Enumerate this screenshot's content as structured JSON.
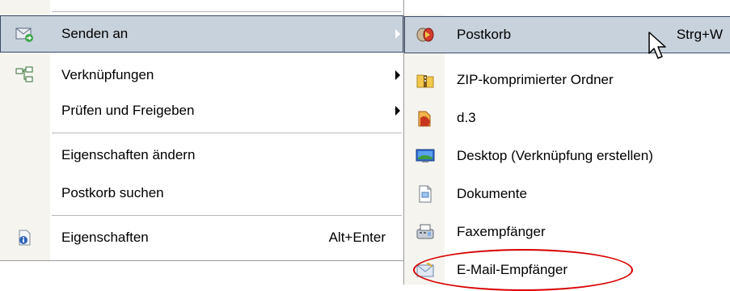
{
  "left_menu": {
    "items": [
      {
        "label": "Senden an",
        "icon": "envelope-arrow-icon",
        "submenu": true,
        "highlighted": true
      },
      {
        "label": "Verknüpfungen",
        "icon": "link-tree-icon",
        "submenu": true
      },
      {
        "label": "Prüfen und Freigeben",
        "submenu": true
      },
      {
        "label": "Eigenschaften ändern"
      },
      {
        "label": "Postkorb suchen"
      },
      {
        "label": "Eigenschaften",
        "icon": "properties-icon",
        "shortcut": "Alt+Enter"
      }
    ]
  },
  "right_menu": {
    "items": [
      {
        "label": "Postkorb",
        "icon": "postkorb-icon",
        "shortcut": "Strg+W",
        "highlighted": true
      },
      {
        "label": "ZIP-komprimierter Ordner",
        "icon": "zip-folder-icon"
      },
      {
        "label": "d.3",
        "icon": "d3-icon"
      },
      {
        "label": "Desktop (Verknüpfung erstellen)",
        "icon": "desktop-icon"
      },
      {
        "label": "Dokumente",
        "icon": "documents-icon"
      },
      {
        "label": "Faxempfänger",
        "icon": "fax-icon"
      },
      {
        "label": "E-Mail-Empfänger",
        "icon": "mail-recipient-icon"
      }
    ]
  },
  "colors": {
    "highlight_bg": "#c8d2dc",
    "highlight_border": "#3a4b66",
    "annotation_circle": "#d80000"
  }
}
